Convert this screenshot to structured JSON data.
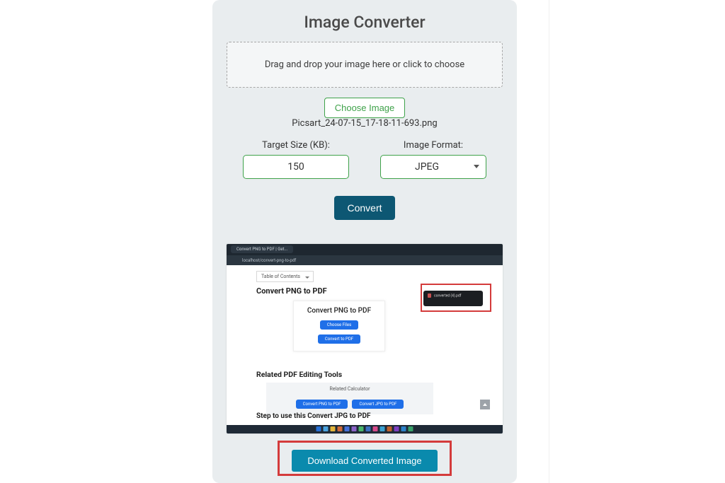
{
  "title": "Image Converter",
  "dropzone_text": "Drag and drop your image here or click to choose",
  "choose_label": "Choose Image",
  "selected_filename": "Picsart_24-07-15_17-18-11-693.png",
  "target_size": {
    "label": "Target Size (KB):",
    "value": "150"
  },
  "format": {
    "label": "Image Format:",
    "value": "JPEG"
  },
  "convert_label": "Convert",
  "download_label": "Download Converted Image",
  "preview": {
    "tab_title": "Convert PNG to PDF | Get...",
    "url": "localhost/convert-png-to-pdf",
    "toc_label": "Table of Contents",
    "heading1": "Convert PNG to PDF",
    "card_title": "Convert PNG to PDF",
    "card_btn1": "Choose Files",
    "card_btn2": "Convert to PDF",
    "heading2": "Related PDF Editing Tools",
    "related_label": "Related Calculator",
    "related_btn1": "Convert PNG to PDF",
    "related_btn2": "Convert JPG to PDF",
    "heading3": "Step to use this Convert JPG to PDF",
    "download_toast": "converted (4).pdf"
  }
}
